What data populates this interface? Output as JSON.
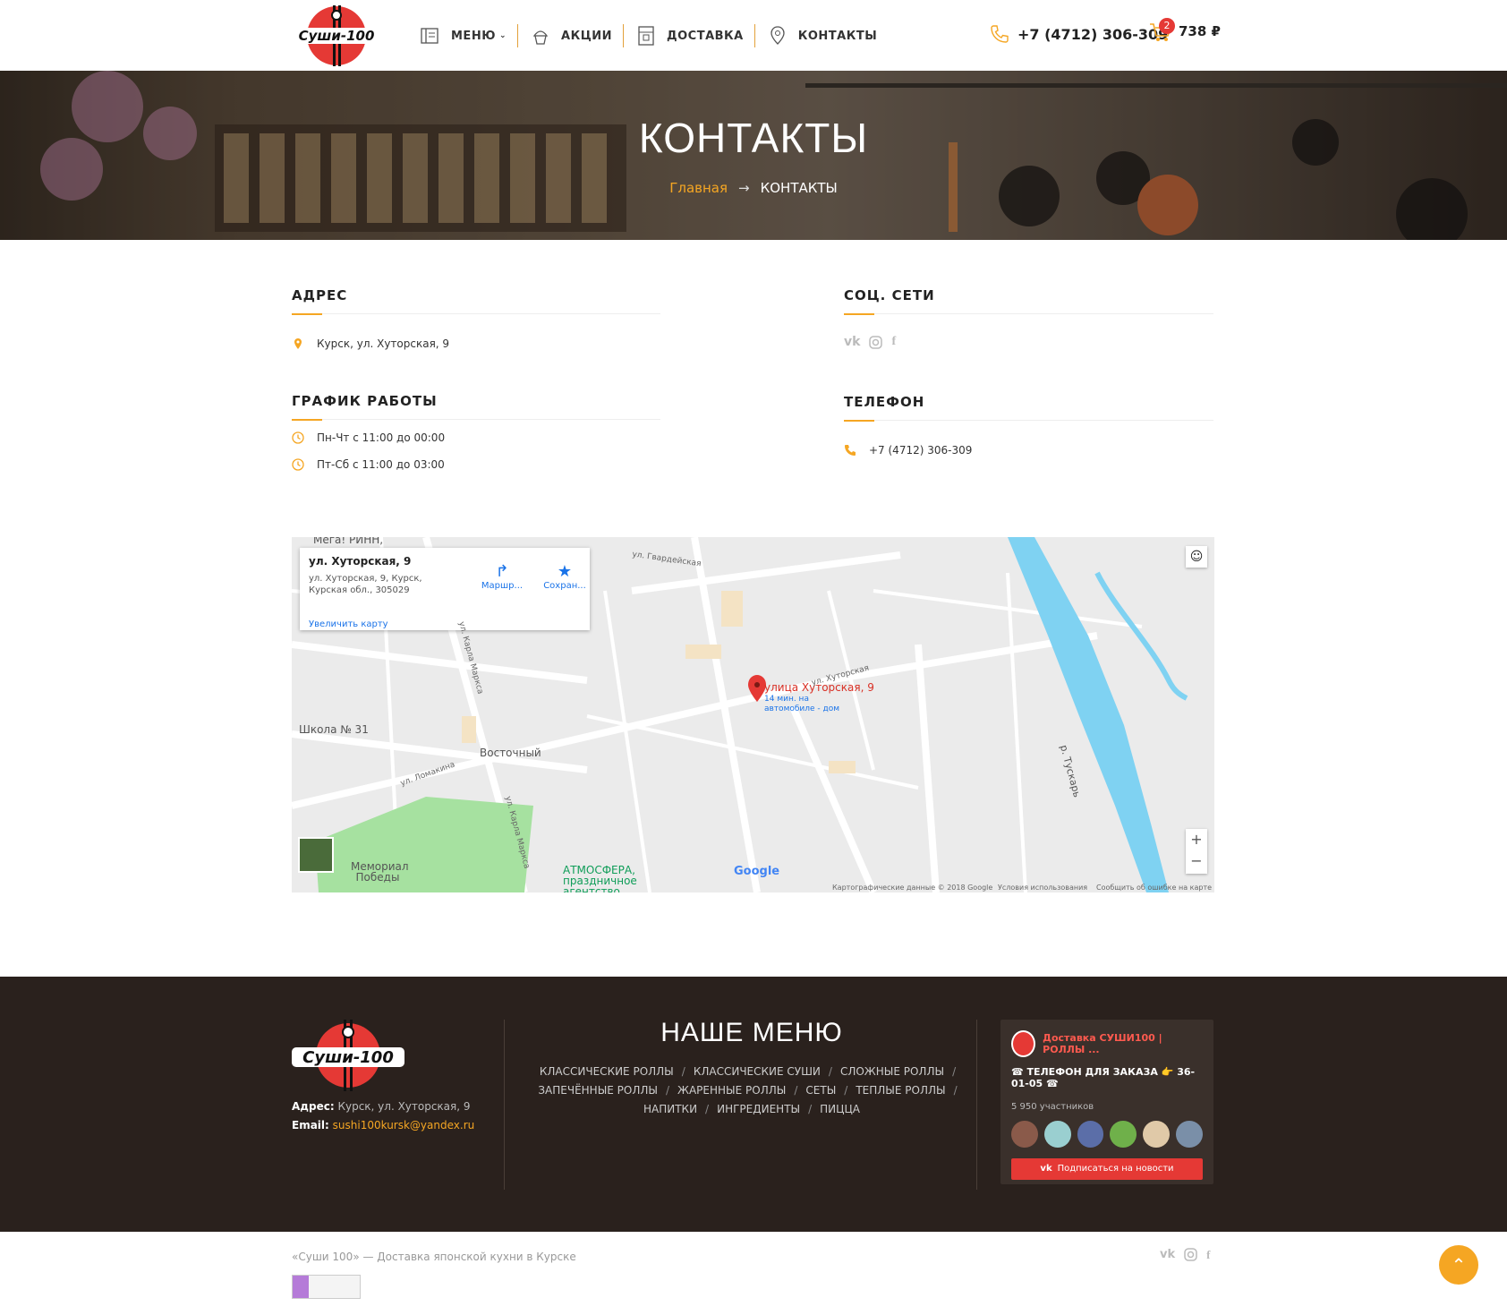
{
  "header": {
    "logo_text": "Суши-100",
    "nav": [
      {
        "label": "МЕНЮ",
        "icon": "menu-book-icon"
      },
      {
        "label": "АКЦИИ",
        "icon": "cupcake-icon"
      },
      {
        "label": "ДОСТАВКА",
        "icon": "delivery-icon"
      },
      {
        "label": "КОНТАКТЫ",
        "icon": "map-pin-icon"
      }
    ],
    "phone": "+7 (4712) 306-309",
    "cart_count": "2",
    "cart_total": "738 ₽"
  },
  "hero": {
    "title": "КОНТАКТЫ",
    "breadcrumb_home": "Главная",
    "breadcrumb_arrow": "→",
    "breadcrumb_current": "КОНТАКТЫ"
  },
  "contacts": {
    "address_title": "АДРЕС",
    "address": "Курск, ул. Хуторская, 9",
    "schedule_title": "ГРАФИК РАБОТЫ",
    "schedule": [
      "Пн-Чт с 11:00 до 00:00",
      "Пт-Сб с 11:00 до 03:00"
    ],
    "social_title": "СОЦ. СЕТИ",
    "social": [
      "vk",
      "instagram",
      "facebook"
    ],
    "phone_title": "ТЕЛЕФОН",
    "phone": "+7 (4712) 306-309"
  },
  "map": {
    "card_title": "ул. Хуторская, 9",
    "card_address": "ул. Хуторская, 9, Курск, Курская обл., 305029",
    "zoom_link": "Увеличить карту",
    "route": "Маршр...",
    "save": "Сохран...",
    "top_label": "Мега! РИНН,",
    "marker_label": "улица Хуторская, 9",
    "marker_sub": "14 мин. на автомобиле - дом",
    "labels": [
      "Школа № 31",
      "Восточный",
      "Мемориал Победы",
      "АТМОСФЕРА, праздничное агентство",
      "ул. Карла Маркса",
      "р. Тускарь",
      "ул. Хуторская",
      "ул. Гвардейская",
      "ул. Ломакина",
      "ул. Карла Маркса"
    ],
    "google": "Google",
    "attribution": "Картографические данные © 2018 Google",
    "terms": "Условия использования",
    "report": "Сообщить об ошибке на карте",
    "zoom_in": "+",
    "zoom_out": "−"
  },
  "footer": {
    "address_label": "Адрес:",
    "address": "Курск, ул. Хуторская, 9",
    "email_label": "Email:",
    "email": "sushi100kursk@yandex.ru",
    "menu_title": "НАШЕ МЕНЮ",
    "menu_links": [
      "КЛАССИЧЕСКИЕ РОЛЛЫ",
      "КЛАССИЧЕСКИЕ СУШИ",
      "СЛОЖНЫЕ РОЛЛЫ",
      "ЗАПЕЧЁННЫЕ РОЛЛЫ",
      "ЖАРЕННЫЕ РОЛЛЫ",
      "СЕТЫ",
      "ТЕПЛЫЕ РОЛЛЫ",
      "НАПИТКИ",
      "ИНГРЕДИЕНТЫ",
      "ПИЦЦА"
    ],
    "vk": {
      "name": "Доставка СУШИ100 | РОЛЛЫ ...",
      "status": "☎ ТЕЛЕФОН ДЛЯ ЗАКАЗА 👉 36-01-05 ☎",
      "members": "5 950 участников",
      "button": "Подписаться на новости"
    }
  },
  "bottom": {
    "copyright": "«Суши 100» — Доставка японской кухни в Курске"
  },
  "colors": {
    "accent": "#f5a623",
    "brand_red": "#e53935",
    "footer_bg": "#2a211d"
  }
}
